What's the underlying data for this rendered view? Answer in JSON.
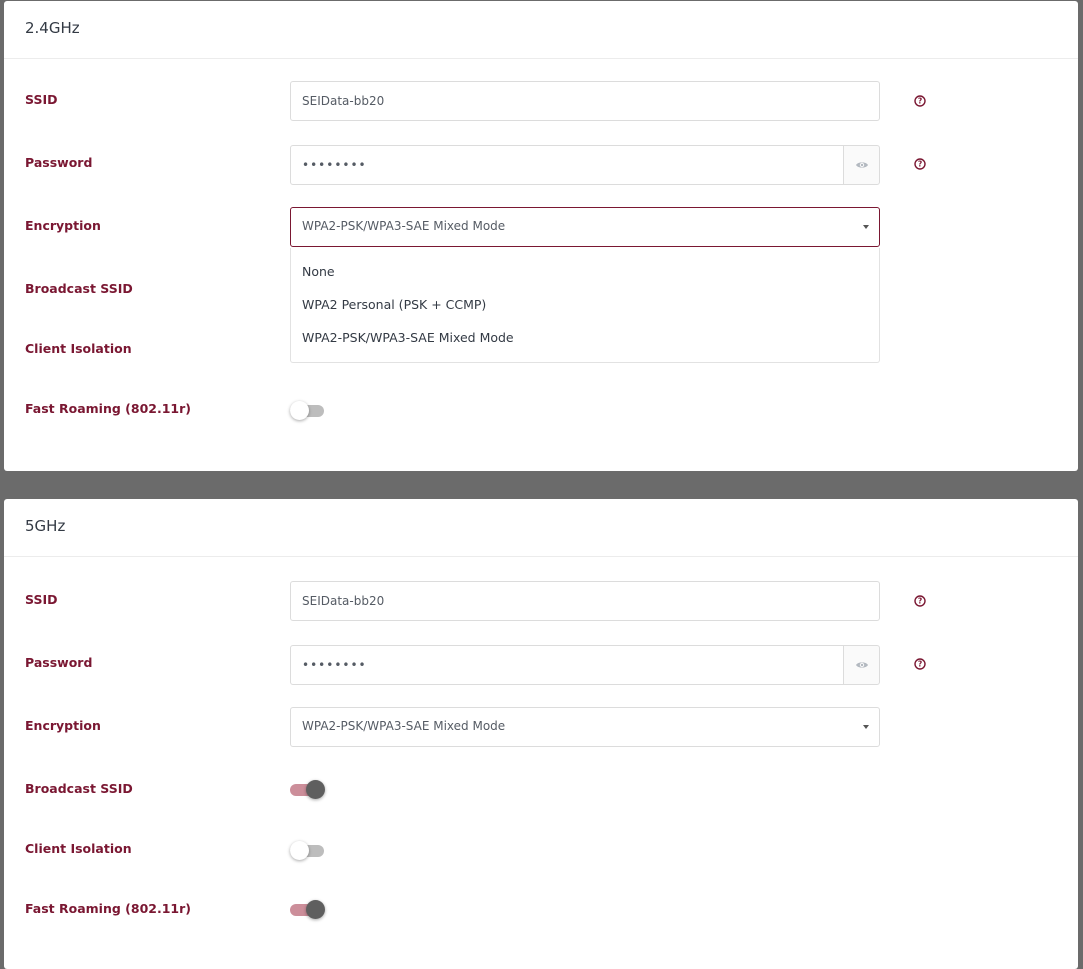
{
  "bands": [
    {
      "title": "2.4GHz",
      "ssid": {
        "label": "SSID",
        "value": "SEIData-bb20"
      },
      "password": {
        "label": "Password",
        "value": "••••••••"
      },
      "encryption": {
        "label": "Encryption",
        "selected": "WPA2-PSK/WPA3-SAE Mixed Mode",
        "options": [
          "None",
          "WPA2 Personal (PSK + CCMP)",
          "WPA2-PSK/WPA3-SAE Mixed Mode"
        ]
      },
      "broadcast_ssid": {
        "label": "Broadcast SSID"
      },
      "client_isolation": {
        "label": "Client Isolation"
      },
      "fast_roaming": {
        "label": "Fast Roaming (802.11r)",
        "on": false
      }
    },
    {
      "title": "5GHz",
      "ssid": {
        "label": "SSID",
        "value": "SEIData-bb20"
      },
      "password": {
        "label": "Password",
        "value": "••••••••"
      },
      "encryption": {
        "label": "Encryption",
        "selected": "WPA2-PSK/WPA3-SAE Mixed Mode"
      },
      "broadcast_ssid": {
        "label": "Broadcast SSID",
        "on": true
      },
      "client_isolation": {
        "label": "Client Isolation",
        "on": false
      },
      "fast_roaming": {
        "label": "Fast Roaming (802.11r)",
        "on": true
      }
    }
  ],
  "icons": {
    "help": "question-circle-icon",
    "show_password": "eye-icon",
    "dropdown": "caret-down-icon"
  },
  "colors": {
    "label": "#7a1732",
    "accent": "#7a1732",
    "toggle_on_track": "#cc8e9a",
    "toggle_on_knob": "#5f5f5f",
    "background": "#6b6b6b"
  }
}
